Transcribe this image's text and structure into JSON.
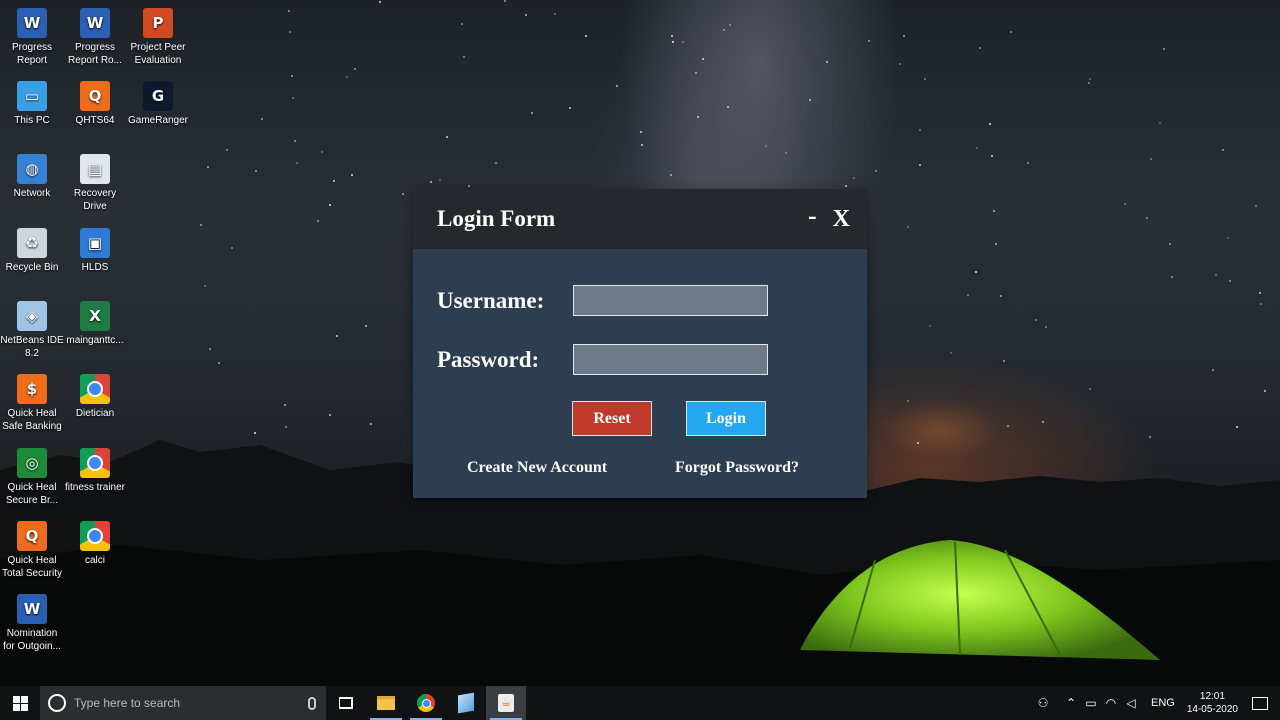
{
  "desktop": {
    "icons": [
      {
        "label": "Progress Report"
      },
      {
        "label": "Progress Report Ro..."
      },
      {
        "label": "Project Peer Evaluation"
      },
      {
        "label": "This PC"
      },
      {
        "label": "QHTS64"
      },
      {
        "label": "GameRanger"
      },
      {
        "label": "Network"
      },
      {
        "label": "Recovery Drive"
      },
      {
        "label": "Recycle Bin"
      },
      {
        "label": "HLDS"
      },
      {
        "label": "NetBeans IDE 8.2"
      },
      {
        "label": "mainganttc..."
      },
      {
        "label": "Quick Heal Safe Banking"
      },
      {
        "label": "Dietician"
      },
      {
        "label": "Quick Heal Secure Br..."
      },
      {
        "label": "fitness trainer"
      },
      {
        "label": "Quick Heal Total Security"
      },
      {
        "label": "calci"
      },
      {
        "label": "Nomination for Outgoin..."
      }
    ]
  },
  "login": {
    "title": "Login Form",
    "minimize": "-",
    "close": "X",
    "username_label": "Username:",
    "username_value": "",
    "password_label": "Password:",
    "password_value": "",
    "reset_label": "Reset",
    "login_label": "Login",
    "create_account": "Create New Account",
    "forgot_password": "Forgot Password?",
    "colors": {
      "background": "#2c3e50",
      "title_bar": "#25292d",
      "reset": "#c0392b",
      "login": "#22a7f0"
    }
  },
  "taskbar": {
    "search_placeholder": "Type here to search",
    "language": "ENG",
    "time": "12:01",
    "date": "14-05-2020",
    "apps": [
      "task-view-icon",
      "file-explorer-icon",
      "chrome-icon",
      "netbeans-icon",
      "java-icon"
    ]
  }
}
